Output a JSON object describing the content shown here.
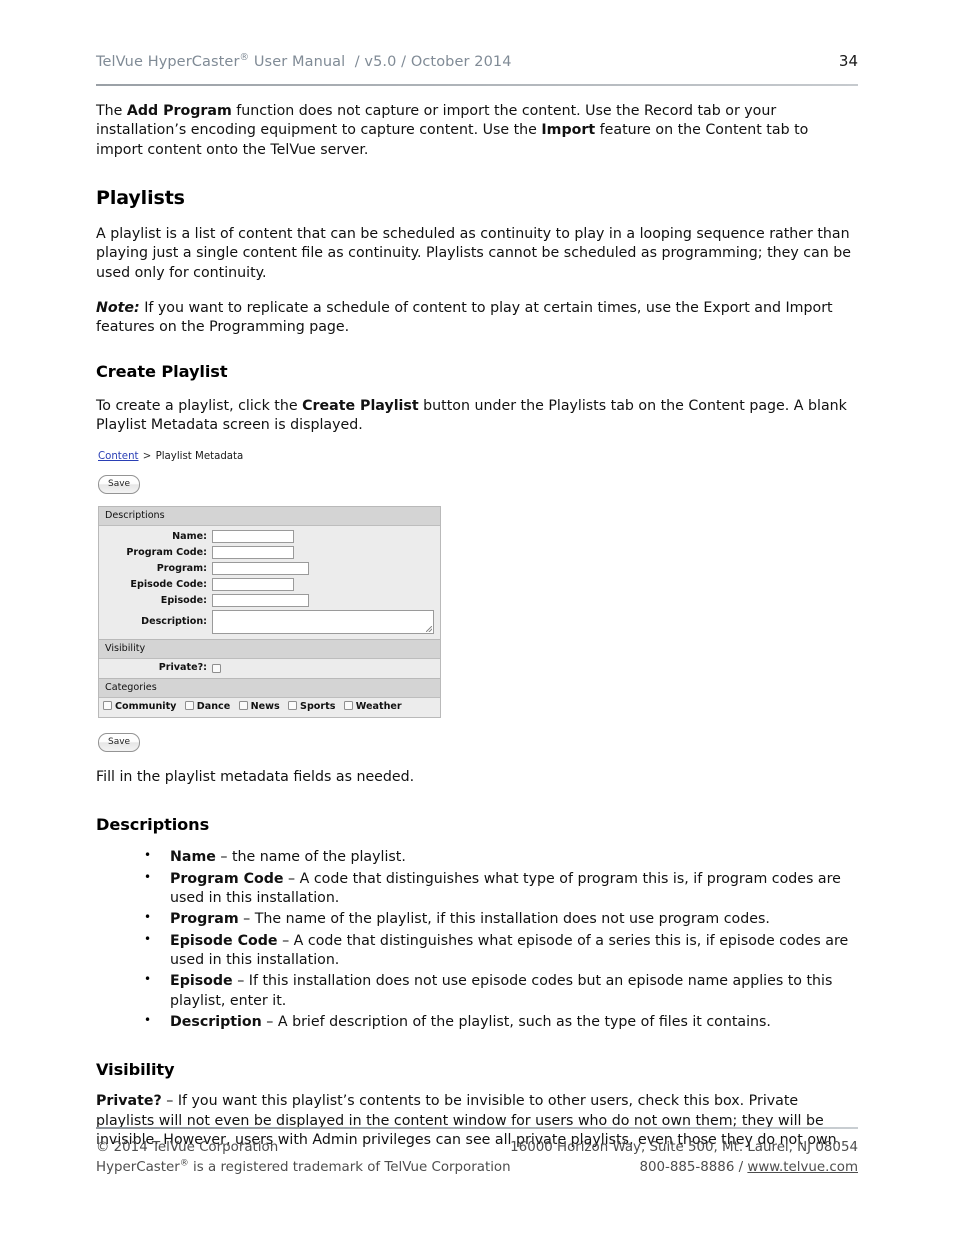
{
  "header": {
    "title_before_sup": "TelVue HyperCaster",
    "title_sup": "®",
    "title_after_sup": " User Manual  / v5.0 / October 2014",
    "page_number": "34"
  },
  "intro": {
    "p1_part1": "The ",
    "p1_bold1": "Add Program",
    "p1_part2": " function does not capture or import the content.  Use the Record tab or your installation’s encoding equipment to capture content.  Use the ",
    "p1_bold2": "Import",
    "p1_part3": " feature on the Content tab to import content onto the TelVue server."
  },
  "playlists": {
    "heading": "Playlists",
    "paragraph": "A playlist is a list of content that can be scheduled as continuity to play in a looping sequence rather than playing just a single content file as continuity.  Playlists cannot be scheduled as programming; they can be used only for continuity.",
    "note_label": "Note:",
    "note_text": " If you want to replicate a schedule of content to play at certain times, use the Export and Import features on the Programming page."
  },
  "create_playlist": {
    "heading": "Create Playlist",
    "p_part1": "To create a playlist, click the ",
    "p_bold": "Create Playlist",
    "p_part2": " button under the Playlists tab on the Content page.  A blank Playlist Metadata screen is displayed.",
    "after_form_text": "Fill in the playlist metadata fields as needed."
  },
  "app_screenshot": {
    "breadcrumb": {
      "link": "Content",
      "separator": ">",
      "current": "Playlist Metadata"
    },
    "save_top_label": "Save",
    "save_bottom_label": "Save",
    "descriptions_panel": {
      "title": "Descriptions",
      "fields": [
        {
          "label": "Name:",
          "value": "",
          "size": "sm"
        },
        {
          "label": "Program Code:",
          "value": "",
          "size": "sm"
        },
        {
          "label": "Program:",
          "value": "",
          "size": "md"
        },
        {
          "label": "Episode Code:",
          "value": "",
          "size": "sm"
        },
        {
          "label": "Episode:",
          "value": "",
          "size": "md"
        },
        {
          "label": "Description:",
          "value": "",
          "size": "textarea"
        }
      ]
    },
    "visibility_panel": {
      "title": "Visibility",
      "private_label": "Private?:",
      "private_checked": false
    },
    "categories_panel": {
      "title": "Categories",
      "items": [
        {
          "label": "Community",
          "checked": false
        },
        {
          "label": "Dance",
          "checked": false
        },
        {
          "label": "News",
          "checked": false
        },
        {
          "label": "Sports",
          "checked": false
        },
        {
          "label": "Weather",
          "checked": false
        }
      ]
    }
  },
  "descriptions_section": {
    "heading": "Descriptions",
    "bullets": [
      {
        "term": "Name",
        "text": " – the name of the playlist."
      },
      {
        "term": "Program Code",
        "text": " – A code that distinguishes what type of program this is, if program codes are used in this installation."
      },
      {
        "term": "Program",
        "text": " – The name of the playlist, if this installation does not use program codes."
      },
      {
        "term": "Episode Code",
        "text": " – A code that distinguishes what episode of a series this is, if episode codes are used in this installation."
      },
      {
        "term": "Episode",
        "text": " – If this installation does not use episode codes but an episode name applies to this playlist, enter it."
      },
      {
        "term": "Description",
        "text": " – A brief description of the playlist, such as the type of files it contains."
      }
    ]
  },
  "visibility_section": {
    "heading": "Visibility",
    "bold_lead": "Private?",
    "text": " – If you want this playlist’s contents to be invisible to other users, check this box.  Private playlists will not even be displayed in the content window for users who do not own them; they will be invisible.  However, users with Admin privileges can see all private playlists, even those they do not own."
  },
  "footer": {
    "copyright": "© 2014 TelVue Corporation",
    "address": "16000 Horizon Way, Suite 500, Mt. Laurel, NJ 08054",
    "trademark_before_sup": "HyperCaster",
    "trademark_sup": "®",
    "trademark_after_sup": " is a registered trademark of TelVue Corporation",
    "phone": "800-885-8886",
    "separator": "/",
    "website": "www.telvue.com"
  }
}
